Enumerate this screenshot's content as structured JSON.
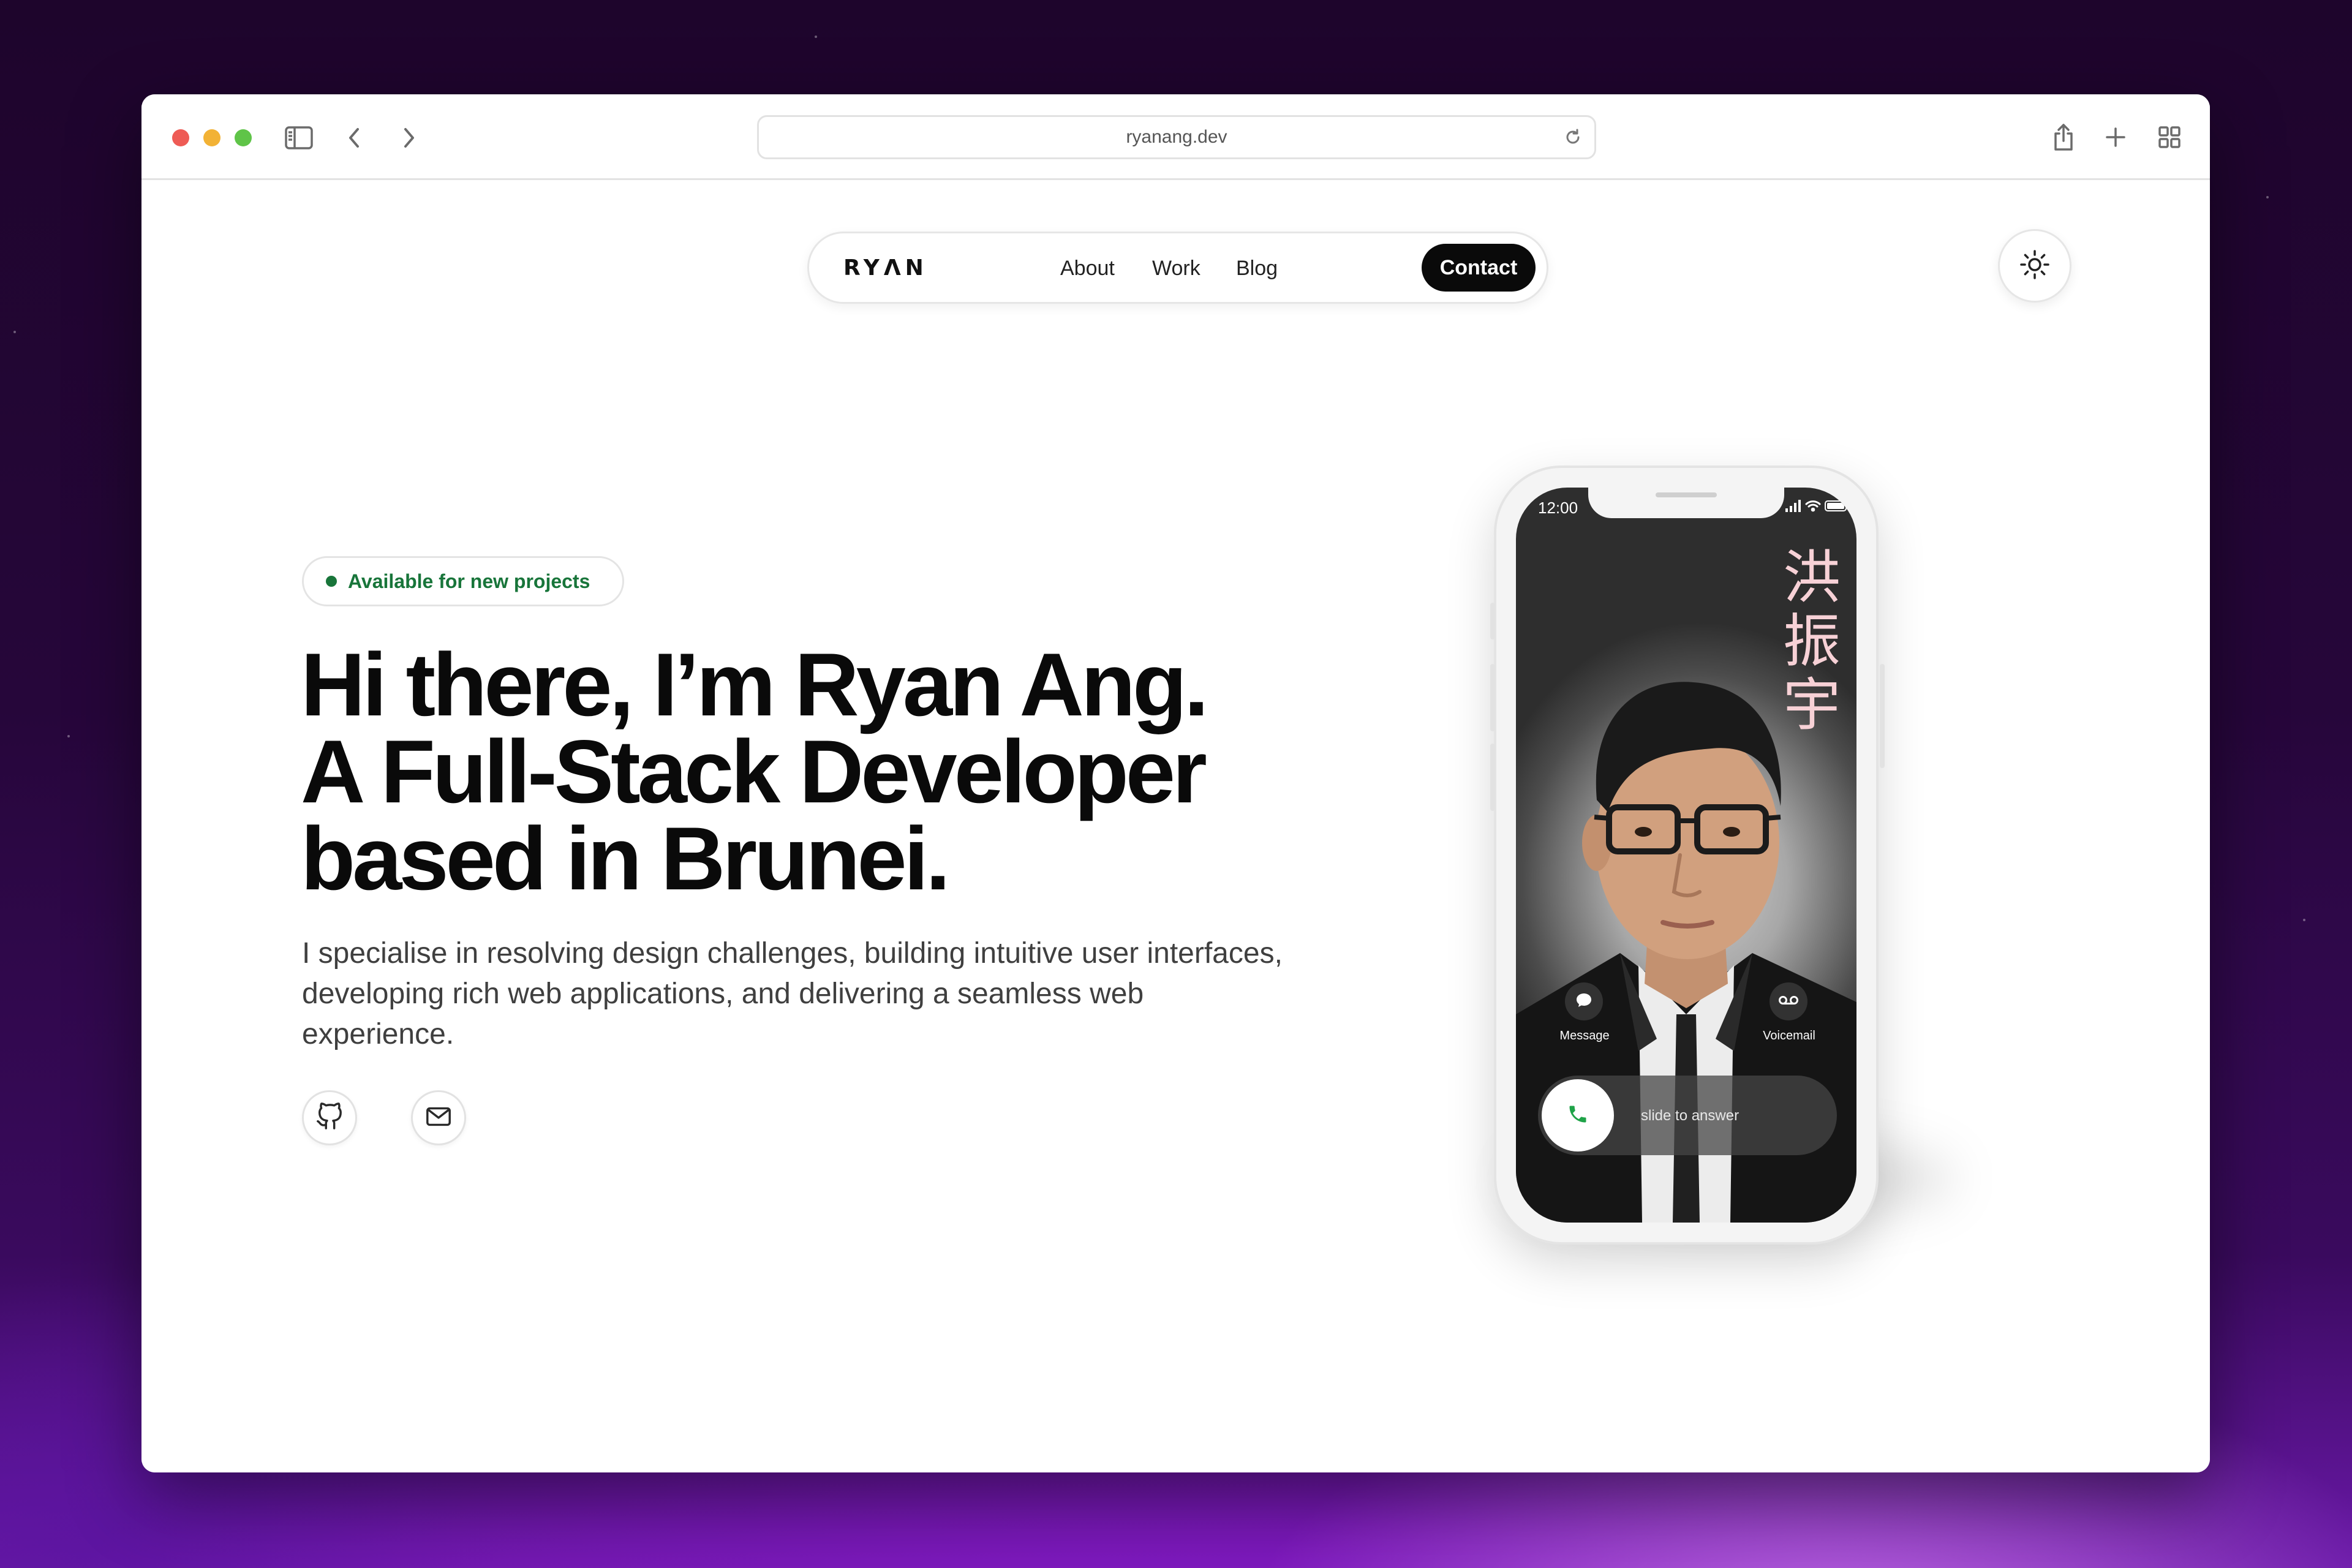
{
  "browser": {
    "url": "ryanang.dev"
  },
  "nav": {
    "logo": "RYΛN",
    "links": [
      "About",
      "Work",
      "Blog"
    ],
    "cta": "Contact"
  },
  "hero": {
    "badge": "Available for new projects",
    "headline": [
      "Hi there, I’m Ryan Ang.",
      "A Full-Stack Developer",
      "based in Brunei."
    ],
    "lead": "I specialise in resolving design challenges, building intuitive user interfaces, developing rich web applications, and delivering a seamless web experience."
  },
  "social": {
    "icons": [
      "github-icon",
      "mail-icon"
    ]
  },
  "phone": {
    "time": "12:00",
    "chinese_name": [
      "洪",
      "振",
      "宇"
    ],
    "left_action": "Message",
    "right_action": "Voicemail",
    "slider_text": "slide to answer"
  },
  "colors": {
    "available_green": "#18753a",
    "contact_bg": "#0a0a0a",
    "name_pink": "#f7d1d6",
    "answer_green": "#1fa348"
  }
}
